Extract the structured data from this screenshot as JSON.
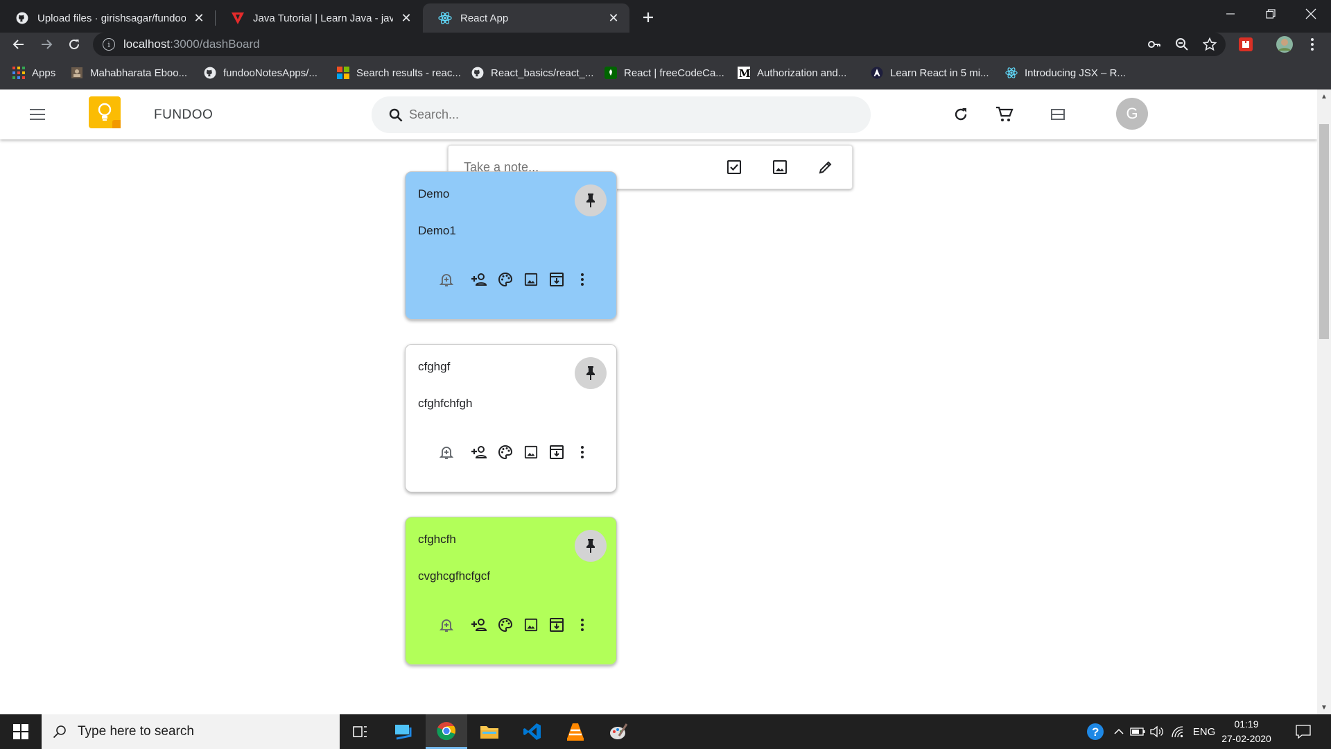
{
  "browser": {
    "tabs": [
      {
        "title": "Upload files · girishsagar/fundoo",
        "icon": "github-icon"
      },
      {
        "title": "Java Tutorial | Learn Java - javatpo",
        "icon": "javatpoint-icon"
      },
      {
        "title": "React App",
        "icon": "react-icon"
      }
    ],
    "url_host": "localhost",
    "url_path": ":3000/dashBoard",
    "bookmarks": [
      {
        "label": "Apps",
        "icon": "apps-grid-icon"
      },
      {
        "label": "Mahabharata Eboo...",
        "icon": "book-icon"
      },
      {
        "label": "fundooNotesApps/...",
        "icon": "github-icon"
      },
      {
        "label": "Search results - reac...",
        "icon": "microsoft-icon"
      },
      {
        "label": "React_basics/react_...",
        "icon": "github-icon"
      },
      {
        "label": "React | freeCodeCa...",
        "icon": "freecodecamp-icon"
      },
      {
        "label": "Authorization and...",
        "icon": "medium-icon"
      },
      {
        "label": "Learn React in 5 mi...",
        "icon": "angular-icon"
      },
      {
        "label": "Introducing JSX – R...",
        "icon": "react-icon"
      }
    ]
  },
  "app": {
    "brand": "FUNDOO",
    "search_placeholder": "Search...",
    "avatar_letter": "G",
    "take_note_placeholder": "Take a note...",
    "notes": [
      {
        "title": "Demo",
        "body": "Demo1",
        "color": "#90caf9"
      },
      {
        "title": "cfghgf",
        "body": "cfghfchfgh",
        "color": "#ffffff"
      },
      {
        "title": "cfghcfh",
        "body": "cvghcgfhcfgcf",
        "color": "#b2ff59"
      }
    ]
  },
  "taskbar": {
    "search_placeholder": "Type here to search",
    "language": "ENG",
    "time": "01:19",
    "date": "27-02-2020"
  }
}
